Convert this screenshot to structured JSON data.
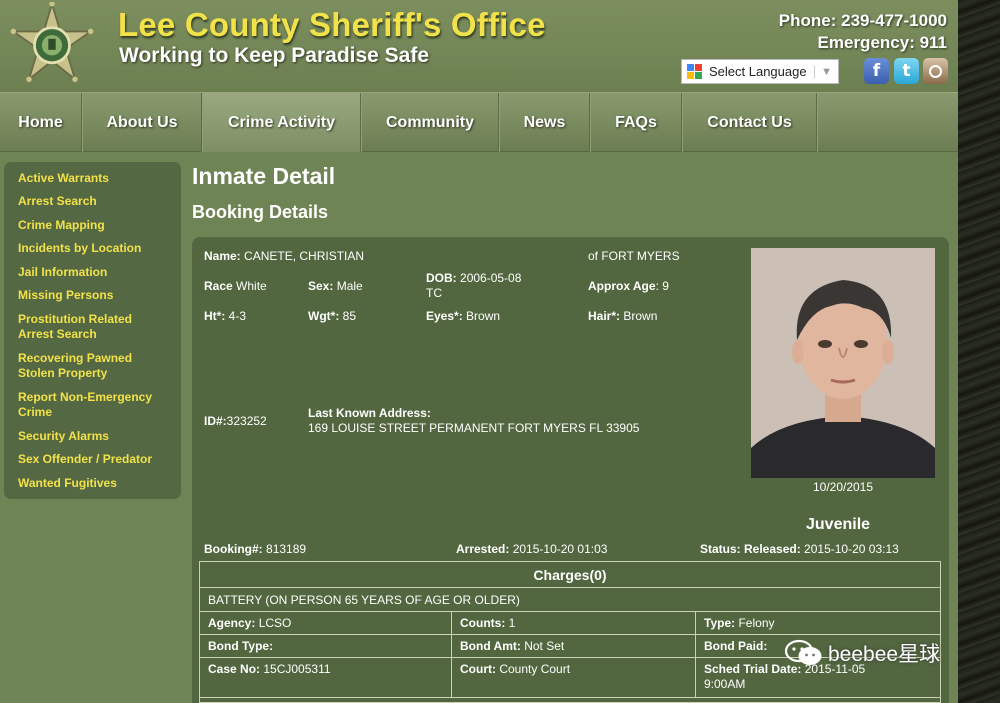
{
  "header": {
    "title": "Lee County Sheriff's Office",
    "tagline": "Working to Keep Paradise Safe",
    "phone": "Phone: 239-477-1000",
    "emergency": "Emergency: 911",
    "translate_label": "Select Language",
    "social": [
      "facebook",
      "twitter",
      "instagram"
    ]
  },
  "nav": {
    "items": [
      "Home",
      "About Us",
      "Crime Activity",
      "Community",
      "News",
      "FAQs",
      "Contact Us"
    ],
    "active": "Crime Activity"
  },
  "sidebar": {
    "items": [
      "Active Warrants",
      "Arrest Search",
      "Crime Mapping",
      "Incidents by Location",
      "Jail Information",
      "Missing Persons",
      "Prostitution Related Arrest Search",
      "Recovering Pawned Stolen Property",
      "Report Non-Emergency Crime",
      "Security Alarms",
      "Sex Offender / Predator",
      "Wanted Fugitives"
    ]
  },
  "main": {
    "title": "Inmate Detail",
    "subtitle": "Booking Details",
    "name_label": "Name:",
    "name": "CANETE, CHRISTIAN",
    "city": "of FORT MYERS",
    "race_label": "Race",
    "race": "White",
    "sex_label": "Sex:",
    "sex": "Male",
    "dob_label": "DOB:",
    "dob": "2006-05-08",
    "dob_note": "TC",
    "age_label": "Approx Age",
    "age": "9",
    "height_label": "Ht*:",
    "height": "4-3",
    "weight_label": "Wgt*:",
    "weight": "85",
    "eyes_label": "Eyes*:",
    "eyes": "Brown",
    "hair_label": "Hair*:",
    "hair": "Brown",
    "id_label": "ID#:",
    "id": "323252",
    "address_label": "Last Known Address:",
    "address": "169 LOUISE STREET PERMANENT FORT MYERS FL 33905",
    "photo_date": "10/20/2015",
    "juvenile": "Juvenile",
    "booking_label": "Booking#:",
    "booking": "813189",
    "arrested_label": "Arrested:",
    "arrested": "2015-10-20 01:03",
    "status_label": "Status: Released:",
    "status": "2015-10-20 03:13"
  },
  "charges": {
    "header": "Charges(0)",
    "description": "BATTERY (ON PERSON 65 YEARS OF AGE OR OLDER)",
    "agency_label": "Agency:",
    "agency": "LCSO",
    "counts_label": "Counts:",
    "counts": "1",
    "type_label": "Type:",
    "type": "Felony",
    "bond_type_label": "Bond Type:",
    "bond_type": "",
    "bond_amt_label": "Bond Amt:",
    "bond_amt": "Not Set",
    "bond_paid_label": "Bond Paid:",
    "bond_paid": "",
    "case_label": "Case No:",
    "case": "15CJ005311",
    "court_label": "Court:",
    "court": "County Court",
    "trial_label": "Sched Trial Date:",
    "trial": "2015-11-05",
    "trial_time": "9:00AM"
  },
  "watermark": "beebee星球",
  "colors": {
    "page_bg": "#6f8454",
    "panel_bg": "#52663f",
    "title_yellow": "#f2e24a",
    "link_yellow": "#f2e24a"
  }
}
